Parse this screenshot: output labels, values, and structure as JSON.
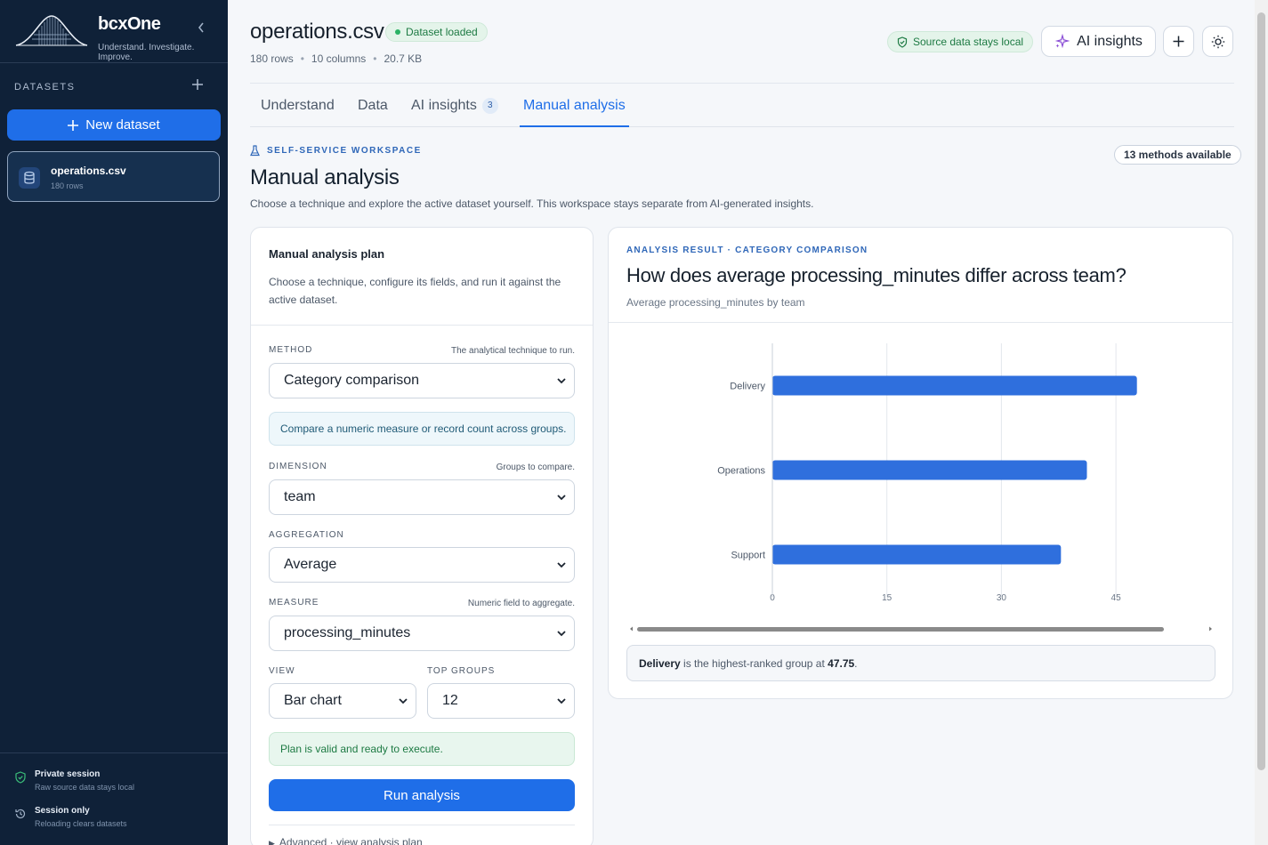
{
  "sidebar": {
    "brand": {
      "logo": "bcxOne",
      "tagline": "Understand. Investigate. Improve."
    },
    "datasets_heading": "DATASETS",
    "new_dataset_label": "New dataset",
    "datasets": [
      {
        "name": "operations.csv",
        "rows": "180 rows"
      }
    ],
    "footer": [
      {
        "title": "Private session",
        "subtitle": "Raw source data stays local"
      },
      {
        "title": "Session only",
        "subtitle": "Reloading clears datasets"
      }
    ]
  },
  "header": {
    "file_name": "operations.csv",
    "status_badge": "Dataset loaded",
    "meta": {
      "rows": "180 rows",
      "columns": "10 columns",
      "size": "20.7 KB"
    },
    "local_badge": "Source data stays local",
    "ai_button": "AI insights"
  },
  "tabs": [
    {
      "label": "Understand"
    },
    {
      "label": "Data"
    },
    {
      "label": "AI insights",
      "count": "3"
    },
    {
      "label": "Manual analysis",
      "active": true
    }
  ],
  "workspace": {
    "eyebrow": "SELF-SERVICE WORKSPACE",
    "methods_badge": "13 methods available",
    "title": "Manual analysis",
    "description": "Choose a technique and explore the active dataset yourself. This workspace stays separate from AI-generated insights."
  },
  "plan": {
    "title": "Manual analysis plan",
    "description": "Choose a technique, configure its fields, and run it against the active dataset.",
    "method": {
      "label": "METHOD",
      "hint": "The analytical technique to run.",
      "value": "Category comparison",
      "info": "Compare a numeric measure or record count across groups."
    },
    "dimension": {
      "label": "DIMENSION",
      "hint": "Groups to compare.",
      "value": "team"
    },
    "aggregation": {
      "label": "AGGREGATION",
      "value": "Average"
    },
    "measure": {
      "label": "MEASURE",
      "hint": "Numeric field to aggregate.",
      "value": "processing_minutes"
    },
    "view": {
      "label": "VIEW",
      "value": "Bar chart"
    },
    "top_groups": {
      "label": "TOP GROUPS",
      "value": "12"
    },
    "valid_message": "Plan is valid and ready to execute.",
    "run_button": "Run analysis",
    "advanced": "Advanced · view analysis plan"
  },
  "result": {
    "eyebrow": "ANALYSIS RESULT · CATEGORY COMPARISON",
    "title": "How does average processing_minutes differ across team?",
    "subtitle": "Average processing_minutes by team",
    "callout": {
      "group": "Delivery",
      "middle": " is the highest-ranked group at ",
      "value": "47.75",
      "end": "."
    }
  },
  "chart_data": {
    "type": "bar",
    "orientation": "horizontal",
    "categories": [
      "Delivery",
      "Operations",
      "Support"
    ],
    "values": [
      47.75,
      41.2,
      37.8
    ],
    "xticks": [
      0,
      15,
      30,
      45
    ],
    "xlim": [
      0,
      52.5
    ],
    "grid": true,
    "color": "#2f6fdd"
  },
  "colors": {
    "accent": "#1f6ee8",
    "sidebar": "#0f2138",
    "success": "#1d7a43"
  }
}
